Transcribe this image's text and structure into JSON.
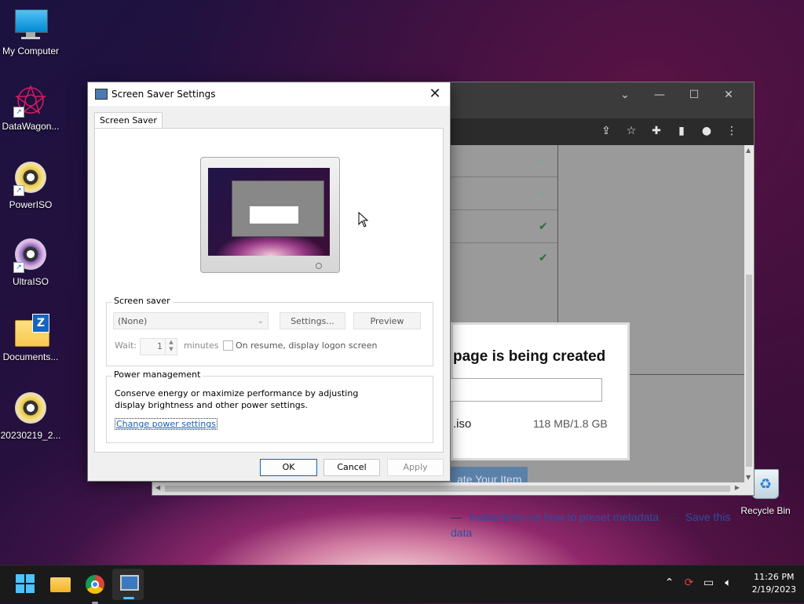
{
  "desktop": {
    "icons": [
      {
        "label": "My Computer",
        "icon": "computer-icon",
        "shortcut": false
      },
      {
        "label": "DataWagon...",
        "icon": "datawagon-icon",
        "shortcut": true
      },
      {
        "label": "PowerISO",
        "icon": "poweriso-icon",
        "shortcut": true
      },
      {
        "label": "UltraISO",
        "icon": "ultraiso-icon",
        "shortcut": true
      },
      {
        "label": "Documents...",
        "icon": "zip-folder-icon",
        "shortcut": false
      },
      {
        "label": "20230219_2...",
        "icon": "disc-image-icon",
        "shortcut": false
      }
    ],
    "recycle_bin": "Recycle Bin"
  },
  "browser": {
    "modal_title": "page is being created",
    "file_name": ".iso",
    "file_size": "118 MB/1.8 GB",
    "button_label": "ate Your Item",
    "link1": "Instructions on how to preset metadata",
    "sep": "—",
    "link2": "Save this",
    "link3": "data",
    "dash1": "—"
  },
  "dialog": {
    "title": "Screen Saver Settings",
    "tab": "Screen Saver",
    "screen_saver_group": "Screen saver",
    "selected_saver": "(None)",
    "settings_button": "Settings...",
    "preview_button": "Preview",
    "wait_label": "Wait:",
    "wait_value": "1",
    "minutes_label": "minutes",
    "resume_label": "On resume, display logon screen",
    "power_group": "Power management",
    "power_text": "Conserve energy or maximize performance by adjusting display brightness and other power settings.",
    "power_link": "Change power settings",
    "ok": "OK",
    "cancel": "Cancel",
    "apply": "Apply"
  },
  "taskbar": {
    "time": "11:26 PM",
    "date": "2/19/2023"
  }
}
